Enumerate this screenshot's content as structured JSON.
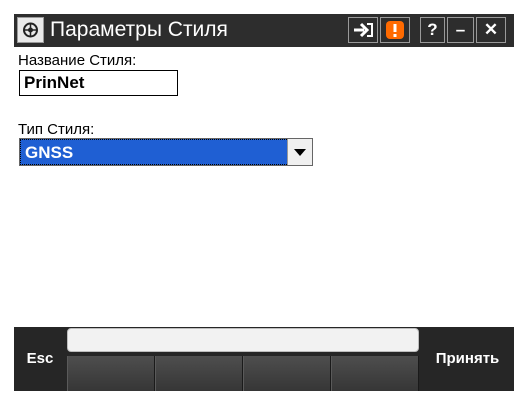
{
  "window": {
    "title": "Параметры Стиля",
    "buttons": {
      "help": "?",
      "minimize": "–",
      "close": "✕"
    }
  },
  "form": {
    "name_label": "Название Стиля:",
    "name_value": "PrinNet",
    "type_label": "Тип Стиля:",
    "type_value": "GNSS"
  },
  "softkeys": {
    "esc": "Esc",
    "accept": "Принять"
  },
  "colors": {
    "titlebar": "#2d2d2d",
    "selection": "#1f5fd3",
    "warning": "#ff6a00"
  },
  "icons": [
    "trimble-app-icon",
    "login-arrow-icon",
    "warning-icon",
    "help-icon",
    "minimize-icon",
    "close-icon",
    "dropdown-arrow-icon"
  ]
}
